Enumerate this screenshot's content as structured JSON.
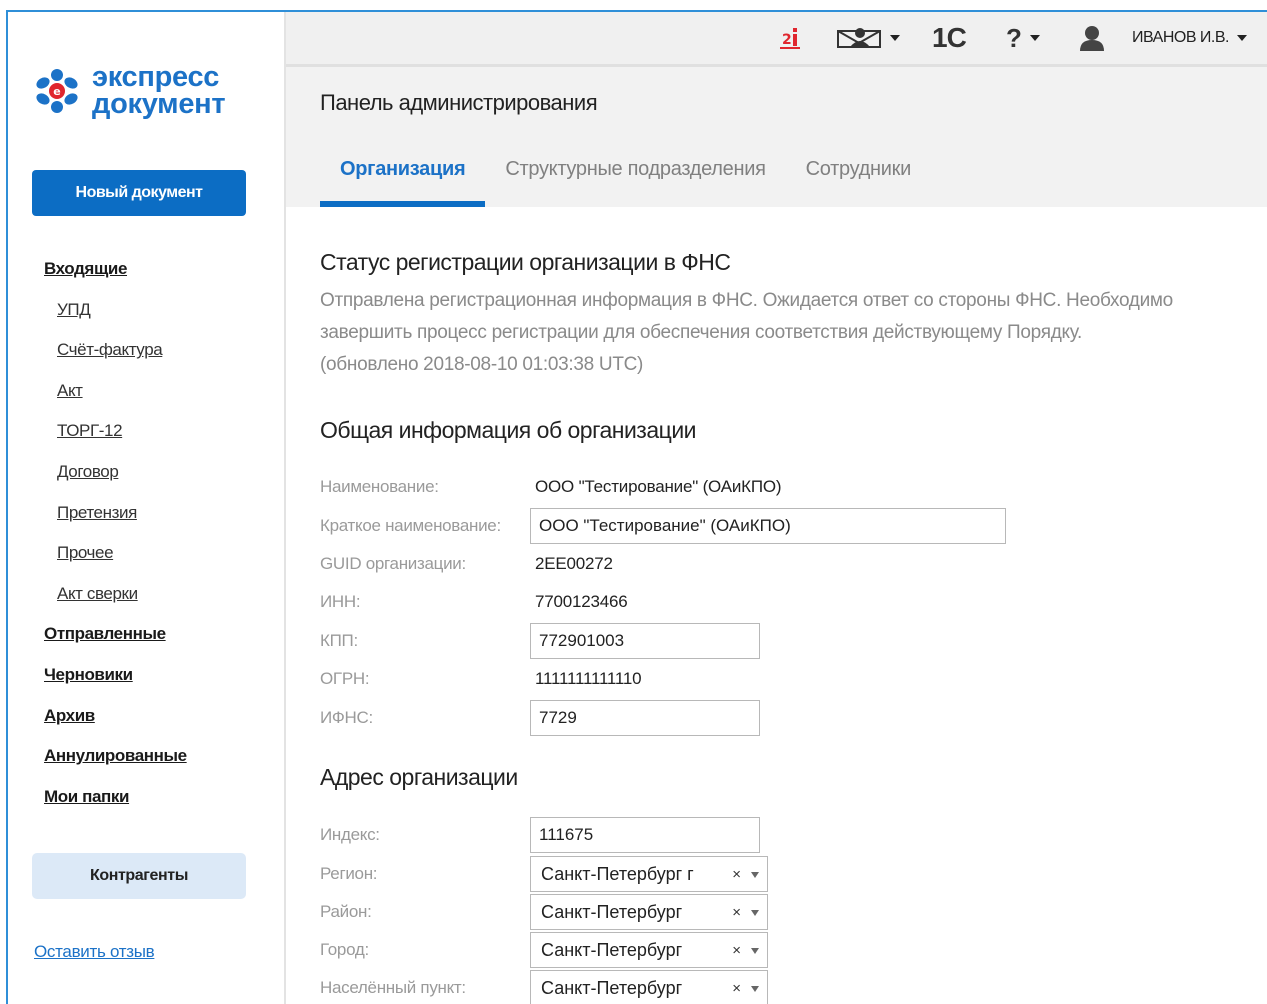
{
  "sidebar": {
    "logo": {
      "line1": "экспресс",
      "line2": "документ"
    },
    "new_doc_button": "Новый документ",
    "nav": [
      {
        "label": "Входящие",
        "level": "top"
      },
      {
        "label": "УПД",
        "level": "sub"
      },
      {
        "label": "Счёт-фактура",
        "level": "sub"
      },
      {
        "label": "Акт",
        "level": "sub"
      },
      {
        "label": "ТОРГ-12",
        "level": "sub"
      },
      {
        "label": "Договор",
        "level": "sub"
      },
      {
        "label": "Претензия",
        "level": "sub"
      },
      {
        "label": "Прочее",
        "level": "sub"
      },
      {
        "label": "Акт сверки",
        "level": "sub"
      },
      {
        "label": "Отправленные",
        "level": "top"
      },
      {
        "label": "Черновики",
        "level": "top"
      },
      {
        "label": "Архив",
        "level": "top"
      },
      {
        "label": "Аннулированные",
        "level": "top"
      },
      {
        "label": "Мои папки",
        "level": "top"
      }
    ],
    "counterparties_button": "Контрагенты",
    "feedback_link": "Оставить отзыв"
  },
  "topbar": {
    "notifications_icon": "notification-icon",
    "mail_icon": "inbox-icon",
    "onec_label": "1С",
    "help_label": "?",
    "user_name": "ИВАНОВ И.В."
  },
  "header": {
    "title": "Панель администрирования",
    "tabs": [
      "Организация",
      "Структурные подразделения",
      "Сотрудники"
    ],
    "active_tab": "Организация"
  },
  "status": {
    "heading": "Статус регистрации организации в ФНС",
    "line1": "Отправлена регистрационная информация в ФНС. Ожидается ответ со стороны ФНС. Необходимо",
    "line2": "завершить процесс регистрации для обеспечения соответствия действующему Порядку.",
    "line3": "(обновлено 2018-08-10 01:03:38 UTC)"
  },
  "general": {
    "heading": "Общая информация об организации",
    "name_label": "Наименование:",
    "name_value": "ООО \"Тестирование\" (ОАиКПО)",
    "short_name_label": "Краткое наименование:",
    "short_name_value": "ООО \"Тестирование\" (ОАиКПО)",
    "guid_label": "GUID организации:",
    "guid_value": "2EE00272",
    "inn_label": "ИНН:",
    "inn_value": "7700123466",
    "kpp_label": "КПП:",
    "kpp_value": "772901003",
    "ogrn_label": "ОГРН:",
    "ogrn_value": "1111111111110",
    "ifns_label": "ИФНС:",
    "ifns_value": "7729"
  },
  "address": {
    "heading": "Адрес организации",
    "index_label": "Индекс:",
    "index_value": "111675",
    "region_label": "Регион:",
    "region_value": "Санкт-Петербург г",
    "district_label": "Район:",
    "district_value": "Санкт-Петербург",
    "city_label": "Город:",
    "city_value": "Санкт-Петербург",
    "locality_label": "Населённый пункт:",
    "locality_value": "Санкт-Петербург",
    "clear_glyph": "×"
  },
  "colors": {
    "accent": "#0c6dc4",
    "link": "#1c72c7",
    "badge_red": "#e0262e"
  }
}
